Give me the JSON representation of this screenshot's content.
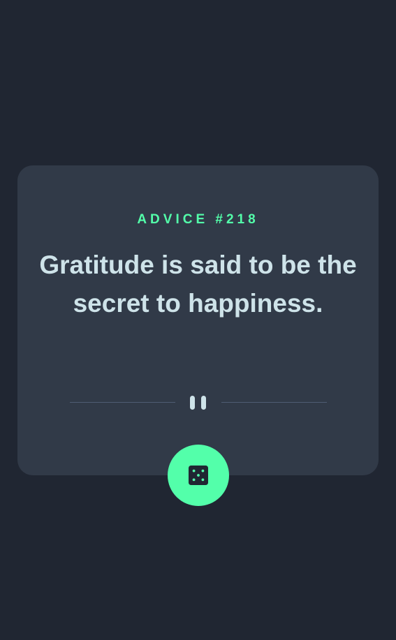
{
  "advice": {
    "label": "ADVICE #218",
    "quote": "Gratitude is said to be the secret to happiness."
  },
  "colors": {
    "background": "#202632",
    "card": "#313a48",
    "accent": "#53ffaa",
    "text": "#cee3e9",
    "divider": "#4f5d74"
  },
  "icons": {
    "divider": "pause-icon",
    "button": "dice-icon"
  }
}
